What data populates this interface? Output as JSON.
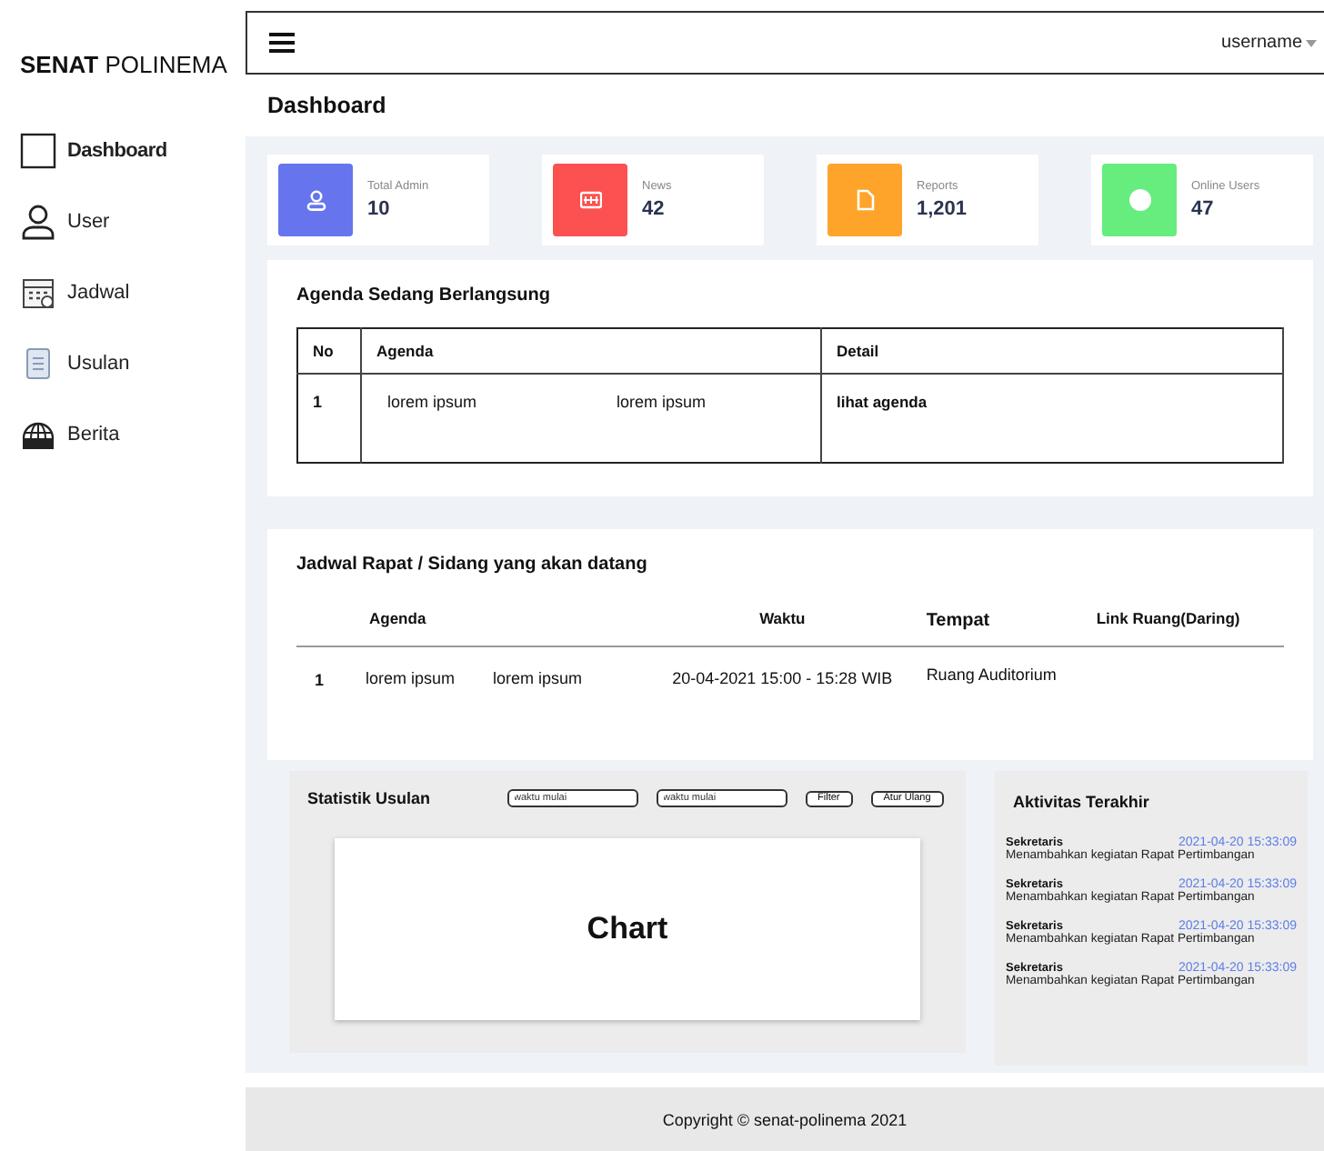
{
  "sidebar": {
    "brand": "**SENAT** POLINEMA",
    "items": [
      {
        "label": "Dashboard",
        "selected": true
      },
      {
        "label": "User",
        "selected": false
      },
      {
        "label": "Jadwal",
        "selected": false
      },
      {
        "label": "Usulan",
        "selected": false
      },
      {
        "label": "Berita",
        "selected": false
      }
    ]
  },
  "topbar": {
    "user": "username"
  },
  "page_title": "Dashboard",
  "stats": [
    {
      "label": "Total Admin",
      "value": "10",
      "color": "#6674ee"
    },
    {
      "label": "News",
      "value": "42",
      "color": "#fb5150"
    },
    {
      "label": "Reports",
      "value": "1,201",
      "color": "#fea42b"
    },
    {
      "label": "Online Users",
      "value": "47",
      "color": "#66ed7e"
    }
  ],
  "agenda": {
    "title": "Agenda Sedang Berlangsung",
    "columns": [
      "No",
      "Agenda",
      "",
      "Detail"
    ],
    "rows": [
      {
        "cells": [
          "1",
          "lorem ipsum",
          "lorem ipsum"
        ],
        "link": "lihat agenda"
      }
    ]
  },
  "schedule": {
    "title": "Jadwal Rapat / Sidang yang akan datang",
    "columns": [
      "",
      "Agenda",
      "",
      "Waktu",
      "Tempat",
      "Link Ruang(Daring)"
    ],
    "rows": [
      {
        "cells": [
          "1",
          "lorem ipsum",
          "lorem ipsum",
          "20-04-2021 15:00 - 15:28 WIB",
          "Ruang Auditorium",
          ""
        ]
      }
    ]
  },
  "statistics": {
    "title": "Statistik Usulan",
    "fields": [
      {
        "placeholder": "waktu mulai"
      },
      {
        "placeholder": "waktu mulai"
      }
    ],
    "buttons": [
      "Filter",
      "Atur Ulang"
    ],
    "chart_placeholder": "Chart"
  },
  "activity": {
    "title": "Aktivitas Terakhir",
    "items": [
      {
        "user": "Sekretaris",
        "time": "2021-04-20 15:33:09",
        "text": "Menambahkan kegiatan Rapat Pertimbangan"
      },
      {
        "user": "Sekretaris",
        "time": "2021-04-20 15:33:09",
        "text": "Menambahkan kegiatan Rapat Pertimbangan"
      },
      {
        "user": "Sekretaris",
        "time": "2021-04-20 15:33:09",
        "text": "Menambahkan kegiatan Rapat Pertimbangan"
      },
      {
        "user": "Sekretaris",
        "time": "2021-04-20 15:33:09",
        "text": "Menambahkan kegiatan Rapat Pertimbangan"
      }
    ]
  },
  "footer": "Copyright © senat-polinema 2021"
}
